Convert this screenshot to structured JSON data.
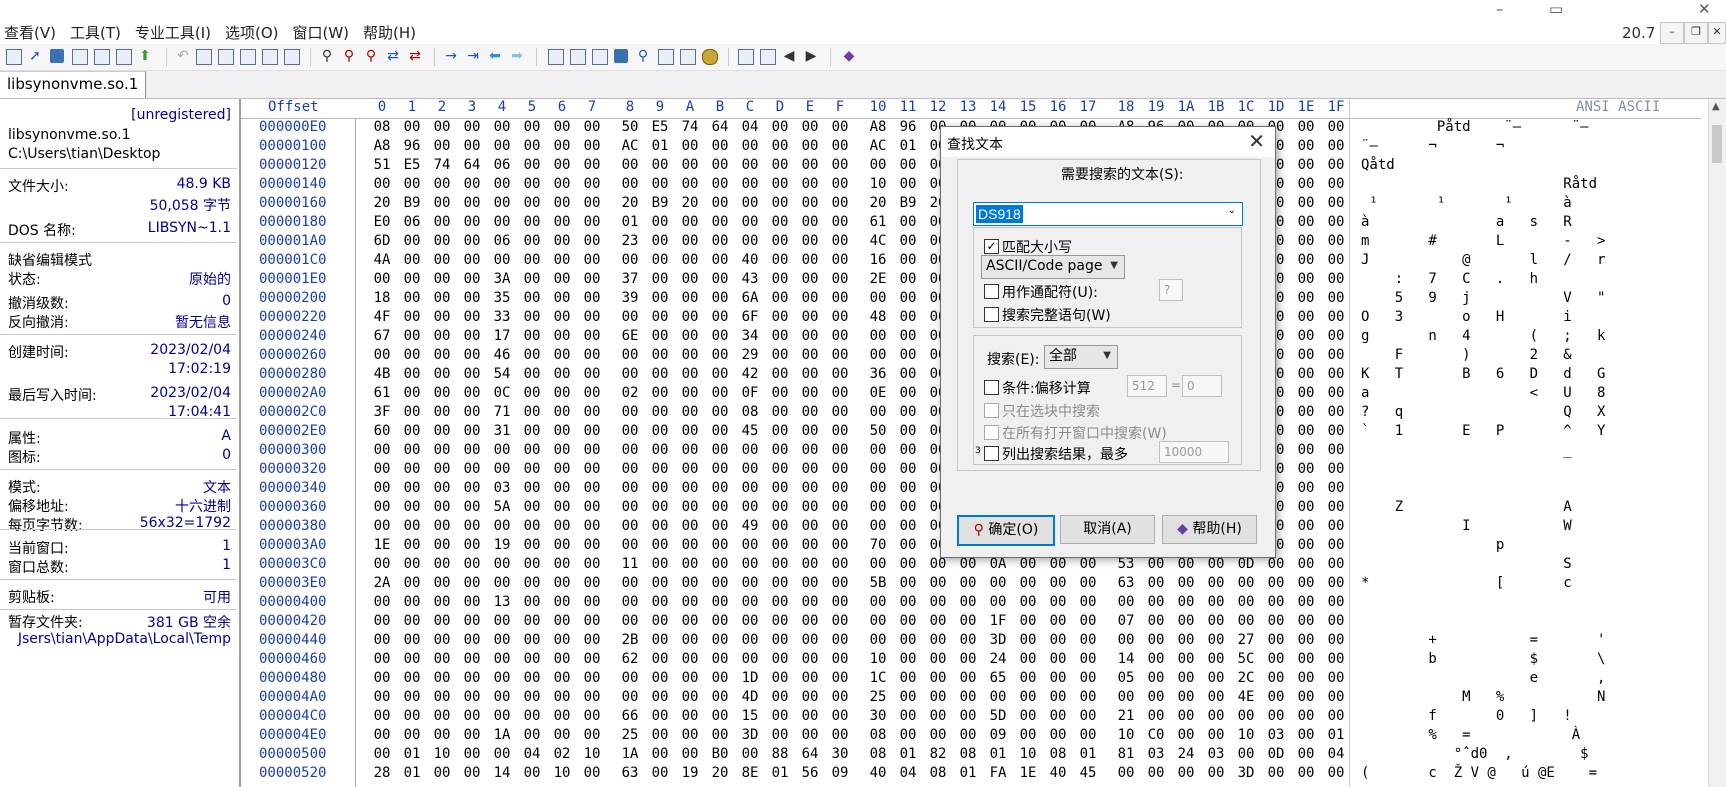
{
  "menu": [
    "查看(V)",
    "工具(T)",
    "专业工具(I)",
    "选项(O)",
    "窗口(W)",
    "帮助(H)"
  ],
  "version": "20.7",
  "window_controls": {
    "minimize": "–",
    "restore": "▭",
    "close": "✕"
  },
  "child_controls": {
    "minimize": "–",
    "restore": "❐",
    "close": "✕"
  },
  "file_tab": "libsynonvme.so.1",
  "info": {
    "unregistered": "[unregistered]",
    "filename": "libsynonvme.so.1",
    "path": "C:\\Users\\tian\\Desktop",
    "size_label": "文件大小:",
    "size_kb": "48.9 KB",
    "size_bytes": "50,058 字节",
    "dos_label": "DOS 名称:",
    "dos_name": "LIBSYN~1.1",
    "edit_mode_label": "缺省编辑模式",
    "state_label": "状态:",
    "state": "原始的",
    "undo_label": "撤消级数:",
    "undo": "0",
    "redo_label": "反向撤消:",
    "redo": "暂无信息",
    "created_label": "创建时间:",
    "created_date": "2023/02/04",
    "created_time": "17:02:19",
    "modified_label": "最后写入时间:",
    "modified_date": "2023/02/04",
    "modified_time": "17:04:41",
    "attr_label": "属性:",
    "attr": "A",
    "icon_label": "图标:",
    "icon": "0",
    "mode_label": "模式:",
    "mode": "文本",
    "offset_label": "偏移地址:",
    "offset": "十六进制",
    "bpp_label": "每页字节数:",
    "bpp": "56x32=1792",
    "curwin_label": "当前窗口:",
    "curwin": "1",
    "totalwin_label": "窗口总数:",
    "totalwin": "1",
    "clip_label": "剪贴板:",
    "clip": "可用",
    "temp_label": "暂存文件夹:",
    "temp_free": "381 GB 空余",
    "temp_path": "Jsers\\tian\\AppData\\Local\\Temp"
  },
  "hex": {
    "offset_header": "Offset",
    "col_headers": [
      "0",
      "1",
      "2",
      "3",
      "4",
      "5",
      "6",
      "7",
      "8",
      "9",
      "A",
      "B",
      "C",
      "D",
      "E",
      "F",
      "10",
      "11",
      "12",
      "13",
      "14",
      "15",
      "16",
      "17",
      "18",
      "19",
      "1A",
      "1B",
      "1C",
      "1D",
      "1E",
      "1F"
    ],
    "ansi_header": "ANSI ASCII",
    "rows": [
      {
        "o": "000000E0",
        "b": "08 00 00 00 00 00 00 00 50 E5 74 64 04 00 00 00 A8 96 00 00 00 00 00 00 A8 96 00 00 00 00 00 00",
        "a": "         Påtd    ¨–      ¨–"
      },
      {
        "o": "00000100",
        "b": "A8 96 00 00 00 00 00 00 AC 01 00 00 00 00 00 00 AC 01 00 00 00 00 00 00 AC 01 00 00 00 00 00 00",
        "a": "¨–      ¬       ¬"
      },
      {
        "o": "00000120",
        "b": "51 E5 74 64 06 00 00 00 00 00 00 00 00 00 00 00 00 00 00 00 00 00 00 00 00 00 00 00 00 00 00 00",
        "a": "Qåtd"
      },
      {
        "o": "00000140",
        "b": "00 00 00 00 00 00 00 00 00 00 00 00 00 00 00 00 10 00 00 00 00 00 00 00 52 E5 74 64 04 00 00 00",
        "a": "                        Råtd"
      },
      {
        "o": "00000160",
        "b": "20 B9 00 00 00 00 00 00 20 B9 20 00 00 00 00 00 20 B9 20 00 00 00 00 00 E0 06 00 00 00 00 00 00",
        "a": " ¹       ¹       ¹      à"
      },
      {
        "o": "00000180",
        "b": "E0 06 00 00 00 00 00 00 01 00 00 00 00 00 00 00 61 00 00 00 00 00 00 00 73 00 00 00 52 00 00 00",
        "a": "à               a   s   R"
      },
      {
        "o": "000001A0",
        "b": "6D 00 00 00 06 00 00 00 23 00 00 00 00 00 00 00 4C 00 00 00 00 00 00 00 2D 00 00 00 3E 00 00 00",
        "a": "m       #       L       -   >"
      },
      {
        "o": "000001C0",
        "b": "4A 00 00 00 00 00 00 00 00 00 00 00 40 00 00 00 16 00 00 00 6C 00 00 00 2F 00 00 00 72 00 00 00",
        "a": "J           @       l   /   r"
      },
      {
        "o": "000001E0",
        "b": "00 00 00 00 3A 00 00 00 37 00 00 00 43 00 00 00 2E 00 00 00 68 00 00 00 00 00 00 00 00 00 00 00",
        "a": "    :   7   C   .   h"
      },
      {
        "o": "00000200",
        "b": "18 00 00 00 35 00 00 00 39 00 00 00 6A 00 00 00 00 00 00 00 00 00 00 00 56 00 00 00 22 00 00 00",
        "a": "    5   9   j           V   \""
      },
      {
        "o": "00000220",
        "b": "4F 00 00 00 33 00 00 00 00 00 00 00 6F 00 00 00 48 00 00 00 00 00 00 00 69 00 00 00 00 00 00 00",
        "a": "O   3       o   H       i"
      },
      {
        "o": "00000240",
        "b": "67 00 00 00 17 00 00 00 6E 00 00 00 34 00 00 00 00 00 00 00 28 00 00 00 3B 00 00 00 6B 00 00 00",
        "a": "g       n   4       (   ;   k"
      },
      {
        "o": "00000260",
        "b": "00 00 00 00 46 00 00 00 00 00 00 00 29 00 00 00 00 00 00 00 32 00 00 00 26 00 00 00 00 00 00 00",
        "a": "    F       )       2   &"
      },
      {
        "o": "00000280",
        "b": "4B 00 00 00 54 00 00 00 00 00 00 00 42 00 00 00 36 00 00 00 44 00 00 00 64 00 00 00 47 00 00 00",
        "a": "K   T       B   6   D   d   G"
      },
      {
        "o": "000002A0",
        "b": "61 00 00 00 0C 00 00 00 02 00 00 00 0F 00 00 00 0E 00 00 00 3C 00 00 00 55 00 00 00 38 00 00 00",
        "a": "a                   <   U   8"
      },
      {
        "o": "000002C0",
        "b": "3F 00 00 00 71 00 00 00 00 00 00 00 08 00 00 00 00 00 00 00 00 00 00 00 51 00 00 00 58 00 00 00",
        "a": "?   q                   Q   X"
      },
      {
        "o": "000002E0",
        "b": "60 00 00 00 31 00 00 00 00 00 00 00 45 00 00 00 50 00 00 00 00 00 00 00 5E 00 00 00 59 00 00 00",
        "a": "`   1       E   P       ^   Y"
      },
      {
        "o": "00000300",
        "b": "00 00 00 00 00 00 00 00 00 00 00 00 00 00 00 00 00 00 00 00 00 00 00 00 5F 00 00 00 00 00 00 00",
        "a": "                        _"
      },
      {
        "o": "00000320",
        "b": "00 00 00 00 00 00 00 00 00 00 00 00 00 00 00 00 00 00 00 00 00 00 00 00 00 00 00 00 00 00 00 00",
        "a": ""
      },
      {
        "o": "00000340",
        "b": "00 00 00 00 03 00 00 00 00 00 00 00 00 00 00 00 00 00 00 00 00 00 00 00 00 00 00 00 00 00 00 00",
        "a": ""
      },
      {
        "o": "00000360",
        "b": "00 00 00 00 5A 00 00 00 00 00 00 00 00 00 00 00 00 00 00 00 00 00 00 00 41 00 00 00 00 00 00 00",
        "a": "    Z                   A"
      },
      {
        "o": "00000380",
        "b": "00 00 00 00 00 00 00 00 00 00 00 00 49 00 00 00 00 00 00 00 00 00 00 00 57 00 00 00 00 00 00 00",
        "a": "            I           W"
      },
      {
        "o": "000003A0",
        "b": "1E 00 00 00 19 00 00 00 00 00 00 00 00 00 00 00 70 00 00 00 00 00 00 00 00 00 00 00 00 00 00 00",
        "a": "                p"
      },
      {
        "o": "000003C0",
        "b": "00 00 00 00 00 00 00 00 11 00 00 00 00 00 00 00 00 00 00 00 0A 00 00 00 53 00 00 00 0D 00 00 00",
        "a": "                        S"
      },
      {
        "o": "000003E0",
        "b": "2A 00 00 00 00 00 00 00 00 00 00 00 00 00 00 00 5B 00 00 00 00 00 00 00 63 00 00 00 00 00 00 00",
        "a": "*               [       c"
      },
      {
        "o": "00000400",
        "b": "00 00 00 00 13 00 00 00 00 00 00 00 00 00 00 00 00 00 00 00 00 00 00 00 00 00 00 00 00 00 00 00",
        "a": ""
      },
      {
        "o": "00000420",
        "b": "00 00 00 00 00 00 00 00 00 00 00 00 00 00 00 00 00 00 00 00 1F 00 00 00 07 00 00 00 00 00 00 00",
        "a": ""
      },
      {
        "o": "00000440",
        "b": "00 00 00 00 00 00 00 00 2B 00 00 00 00 00 00 00 00 00 00 00 3D 00 00 00 00 00 00 00 27 00 00 00",
        "a": "        +           =       '"
      },
      {
        "o": "00000460",
        "b": "00 00 00 00 00 00 00 00 62 00 00 00 00 00 00 00 10 00 00 00 24 00 00 00 14 00 00 00 5C 00 00 00",
        "a": "        b           $       \\"
      },
      {
        "o": "00000480",
        "b": "00 00 00 00 00 00 00 00 00 00 00 00 1D 00 00 00 1C 00 00 00 65 00 00 00 05 00 00 00 2C 00 00 00",
        "a": "                    e       ,"
      },
      {
        "o": "000004A0",
        "b": "00 00 00 00 00 00 00 00 00 00 00 00 4D 00 00 00 25 00 00 00 00 00 00 00 00 00 00 00 4E 00 00 00",
        "a": "            M   %           N"
      },
      {
        "o": "000004C0",
        "b": "00 00 00 00 00 00 00 00 66 00 00 00 15 00 00 00 30 00 00 00 5D 00 00 00 21 00 00 00 00 00 00 00",
        "a": "        f       0   ]   !"
      },
      {
        "o": "000004E0",
        "b": "00 00 00 00 1A 00 00 00 25 00 00 00 3D 00 00 00 08 00 00 00 09 00 00 00 10 C0 00 00 10 03 00 01",
        "a": "        %   =            À"
      },
      {
        "o": "00000500",
        "b": "00 01 10 00 00 04 02 10 1A 00 00 B0 00 88 64 30 08 01 82 08 01 10 08 01 81 03 24 03 00 0D 00 04",
        "a": "           °ˆd0  ‚        $"
      },
      {
        "o": "00000520",
        "b": "28 01 00 00 14 00 10 00 63 00 19 20 8E 01 56 09 40 04 08 01 FA 1E 40 45 00 00 00 00 3D 00 00 00",
        "a": "(       c  Ž V @   ú @E    ="
      }
    ]
  },
  "dialog": {
    "title": "查找文本",
    "search_label": "需要搜索的文本(S):",
    "search_value": "DS918",
    "match_case": "匹配大小写",
    "charset": "ASCII/Code page",
    "wildcard": "用作通配符(U):",
    "wildcard_char": "?",
    "whole_words": "搜索完整语句(W)",
    "search_dir_label": "搜索(E):",
    "search_dir": "全部",
    "cond_offset": "条件:偏移计算",
    "cond_a": "512",
    "cond_eq": "=",
    "cond_b": "0",
    "in_block": "只在选块中搜索",
    "all_windows": "在所有打开窗口中搜索(W)",
    "list_results": "列出搜索结果，最多",
    "list_prefix": "3",
    "list_max": "10000",
    "ok": "确定(O)",
    "cancel": "取消(A)",
    "help": "帮助(H)"
  }
}
